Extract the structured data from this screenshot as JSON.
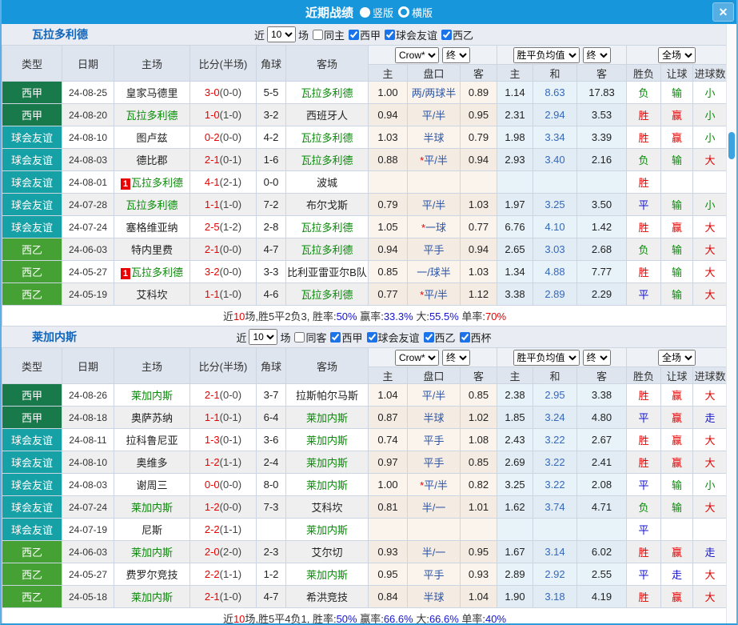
{
  "titlebar": {
    "title": "近期战绩",
    "close_glyph": "✕",
    "radio_options": [
      {
        "label": "竖版",
        "selected": true
      },
      {
        "label": "横版",
        "selected": false
      }
    ]
  },
  "colors": {
    "titlebar_bg": "#1896dc",
    "team_focus": "#0a8a0a",
    "score_ft": "#e60000",
    "score_ht": "#444444",
    "handicap": "#2d55a5",
    "handicap_star": "#e60000",
    "avg_mid": "#3668bb",
    "scroll_thumb": "#3da2e0"
  },
  "league_colors": {
    "西甲": "#18794b",
    "球会友谊": "#16a1a7",
    "西乙": "#45a133"
  },
  "result_colors": {
    "胜": "#e60000",
    "平": "#1515cc",
    "负": "#0a8a0a",
    "赢": "#e60000",
    "输": "#0a8a0a",
    "走": "#1515cc",
    "大": "#e60000",
    "小": "#0a8a0a"
  },
  "table_header": {
    "cols": [
      "类型",
      "日期",
      "主场",
      "比分(半场)",
      "角球",
      "客场"
    ],
    "odds_selects": [
      "Crow*",
      "终"
    ],
    "avg_selects": [
      "胜平负均值",
      "终"
    ],
    "scope_select": "全场",
    "sub": [
      "主",
      "盘口",
      "客",
      "主",
      "和",
      "客",
      "胜负",
      "让球",
      "进球数"
    ]
  },
  "tables": [
    {
      "team": "瓦拉多利德",
      "filter": {
        "prefix": "近",
        "count": "10",
        "suffix": "场",
        "same": {
          "label": "同主",
          "checked": false
        },
        "leagues": [
          {
            "label": "西甲",
            "checked": true
          },
          {
            "label": "球会友谊",
            "checked": true
          },
          {
            "label": "西乙",
            "checked": true
          }
        ]
      },
      "rows": [
        {
          "lg": "西甲",
          "date": "24-08-25",
          "home": "皇家马德里",
          "hb": "",
          "sc": "3-0",
          "hf": "(0-0)",
          "cn": "5-5",
          "away": "瓦拉多利德",
          "ab": "",
          "o1": "1.00",
          "hc": "两/两球半",
          "o2": "0.89",
          "a1": "1.14",
          "a2": "8.63",
          "a3": "17.83",
          "r1": "负",
          "r2": "输",
          "r3": "小"
        },
        {
          "lg": "西甲",
          "date": "24-08-20",
          "home": "瓦拉多利德",
          "hb": "",
          "sc": "1-0",
          "hf": "(1-0)",
          "cn": "3-2",
          "away": "西班牙人",
          "ab": "",
          "o1": "0.94",
          "hc": "平/半",
          "o2": "0.95",
          "a1": "2.31",
          "a2": "2.94",
          "a3": "3.53",
          "r1": "胜",
          "r2": "赢",
          "r3": "小"
        },
        {
          "lg": "球会友谊",
          "date": "24-08-10",
          "home": "图卢兹",
          "hb": "",
          "sc": "0-2",
          "hf": "(0-0)",
          "cn": "4-2",
          "away": "瓦拉多利德",
          "ab": "",
          "o1": "1.03",
          "hc": "半球",
          "o2": "0.79",
          "a1": "1.98",
          "a2": "3.34",
          "a3": "3.39",
          "r1": "胜",
          "r2": "赢",
          "r3": "小"
        },
        {
          "lg": "球会友谊",
          "date": "24-08-03",
          "home": "德比郡",
          "hb": "",
          "sc": "2-1",
          "hf": "(0-1)",
          "cn": "1-6",
          "away": "瓦拉多利德",
          "ab": "",
          "o1": "0.88",
          "hc": "*平/半",
          "o2": "0.94",
          "a1": "2.93",
          "a2": "3.40",
          "a3": "2.16",
          "r1": "负",
          "r2": "输",
          "r3": "大"
        },
        {
          "lg": "球会友谊",
          "date": "24-08-01",
          "home": "瓦拉多利德",
          "hb": "1",
          "sc": "4-1",
          "hf": "(2-1)",
          "cn": "0-0",
          "away": "波城",
          "ab": "",
          "o1": "",
          "hc": "",
          "o2": "",
          "a1": "",
          "a2": "",
          "a3": "",
          "r1": "胜",
          "r2": "",
          "r3": ""
        },
        {
          "lg": "球会友谊",
          "date": "24-07-28",
          "home": "瓦拉多利德",
          "hb": "",
          "sc": "1-1",
          "hf": "(1-0)",
          "cn": "7-2",
          "away": "布尔戈斯",
          "ab": "",
          "o1": "0.79",
          "hc": "平/半",
          "o2": "1.03",
          "a1": "1.97",
          "a2": "3.25",
          "a3": "3.50",
          "r1": "平",
          "r2": "输",
          "r3": "小"
        },
        {
          "lg": "球会友谊",
          "date": "24-07-24",
          "home": "塞格维亚纳",
          "hb": "",
          "sc": "2-5",
          "hf": "(1-2)",
          "cn": "2-8",
          "away": "瓦拉多利德",
          "ab": "",
          "o1": "1.05",
          "hc": "*一球",
          "o2": "0.77",
          "a1": "6.76",
          "a2": "4.10",
          "a3": "1.42",
          "r1": "胜",
          "r2": "赢",
          "r3": "大"
        },
        {
          "lg": "西乙",
          "date": "24-06-03",
          "home": "特内里费",
          "hb": "",
          "sc": "2-1",
          "hf": "(0-0)",
          "cn": "4-7",
          "away": "瓦拉多利德",
          "ab": "",
          "o1": "0.94",
          "hc": "平手",
          "o2": "0.94",
          "a1": "2.65",
          "a2": "3.03",
          "a3": "2.68",
          "r1": "负",
          "r2": "输",
          "r3": "大"
        },
        {
          "lg": "西乙",
          "date": "24-05-27",
          "home": "瓦拉多利德",
          "hb": "1",
          "sc": "3-2",
          "hf": "(0-0)",
          "cn": "3-3",
          "away": "比利亚雷亚尔B队",
          "ab": "",
          "o1": "0.85",
          "hc": "一/球半",
          "o2": "1.03",
          "a1": "1.34",
          "a2": "4.88",
          "a3": "7.77",
          "r1": "胜",
          "r2": "输",
          "r3": "大"
        },
        {
          "lg": "西乙",
          "date": "24-05-19",
          "home": "艾科坎",
          "hb": "",
          "sc": "1-1",
          "hf": "(1-0)",
          "cn": "4-6",
          "away": "瓦拉多利德",
          "ab": "",
          "o1": "0.77",
          "hc": "*平/半",
          "o2": "1.12",
          "a1": "3.38",
          "a2": "2.89",
          "a3": "2.29",
          "r1": "平",
          "r2": "输",
          "r3": "大"
        }
      ],
      "summary": [
        {
          "t": "近"
        },
        {
          "t": "10",
          "c": "#e60000"
        },
        {
          "t": "场,胜5平2负3, 胜率:"
        },
        {
          "t": "50%",
          "c": "#1515cc"
        },
        {
          "t": " 赢率:"
        },
        {
          "t": "33.3%",
          "c": "#1515cc"
        },
        {
          "t": " 大:"
        },
        {
          "t": "55.5%",
          "c": "#1515cc"
        },
        {
          "t": " 单率:"
        },
        {
          "t": "70%",
          "c": "#e60000"
        }
      ]
    },
    {
      "team": "莱加内斯",
      "filter": {
        "prefix": "近",
        "count": "10",
        "suffix": "场",
        "same": {
          "label": "同客",
          "checked": false
        },
        "leagues": [
          {
            "label": "西甲",
            "checked": true
          },
          {
            "label": "球会友谊",
            "checked": true
          },
          {
            "label": "西乙",
            "checked": true
          },
          {
            "label": "西杯",
            "checked": true
          }
        ]
      },
      "rows": [
        {
          "lg": "西甲",
          "date": "24-08-26",
          "home": "莱加内斯",
          "hb": "",
          "sc": "2-1",
          "hf": "(0-0)",
          "cn": "3-7",
          "away": "拉斯帕尔马斯",
          "ab": "",
          "o1": "1.04",
          "hc": "平/半",
          "o2": "0.85",
          "a1": "2.38",
          "a2": "2.95",
          "a3": "3.38",
          "r1": "胜",
          "r2": "赢",
          "r3": "大"
        },
        {
          "lg": "西甲",
          "date": "24-08-18",
          "home": "奥萨苏纳",
          "hb": "",
          "sc": "1-1",
          "hf": "(0-1)",
          "cn": "6-4",
          "away": "莱加内斯",
          "ab": "",
          "o1": "0.87",
          "hc": "半球",
          "o2": "1.02",
          "a1": "1.85",
          "a2": "3.24",
          "a3": "4.80",
          "r1": "平",
          "r2": "赢",
          "r3": "走"
        },
        {
          "lg": "球会友谊",
          "date": "24-08-11",
          "home": "拉科鲁尼亚",
          "hb": "",
          "sc": "1-3",
          "hf": "(0-1)",
          "cn": "3-6",
          "away": "莱加内斯",
          "ab": "",
          "o1": "0.74",
          "hc": "平手",
          "o2": "1.08",
          "a1": "2.43",
          "a2": "3.22",
          "a3": "2.67",
          "r1": "胜",
          "r2": "赢",
          "r3": "大"
        },
        {
          "lg": "球会友谊",
          "date": "24-08-10",
          "home": "奥维多",
          "hb": "",
          "sc": "1-2",
          "hf": "(1-1)",
          "cn": "2-4",
          "away": "莱加内斯",
          "ab": "",
          "o1": "0.97",
          "hc": "平手",
          "o2": "0.85",
          "a1": "2.69",
          "a2": "3.22",
          "a3": "2.41",
          "r1": "胜",
          "r2": "赢",
          "r3": "大"
        },
        {
          "lg": "球会友谊",
          "date": "24-08-03",
          "home": "谢周三",
          "hb": "",
          "sc": "0-0",
          "hf": "(0-0)",
          "cn": "8-0",
          "away": "莱加内斯",
          "ab": "",
          "o1": "1.00",
          "hc": "*平/半",
          "o2": "0.82",
          "a1": "3.25",
          "a2": "3.22",
          "a3": "2.08",
          "r1": "平",
          "r2": "输",
          "r3": "小"
        },
        {
          "lg": "球会友谊",
          "date": "24-07-24",
          "home": "莱加内斯",
          "hb": "",
          "sc": "1-2",
          "hf": "(0-0)",
          "cn": "7-3",
          "away": "艾科坎",
          "ab": "",
          "o1": "0.81",
          "hc": "半/一",
          "o2": "1.01",
          "a1": "1.62",
          "a2": "3.74",
          "a3": "4.71",
          "r1": "负",
          "r2": "输",
          "r3": "大"
        },
        {
          "lg": "球会友谊",
          "date": "24-07-19",
          "home": "尼斯",
          "hb": "",
          "sc": "2-2",
          "hf": "(1-1)",
          "cn": "",
          "away": "莱加内斯",
          "ab": "",
          "o1": "",
          "hc": "",
          "o2": "",
          "a1": "",
          "a2": "",
          "a3": "",
          "r1": "平",
          "r2": "",
          "r3": ""
        },
        {
          "lg": "西乙",
          "date": "24-06-03",
          "home": "莱加内斯",
          "hb": "",
          "sc": "2-0",
          "hf": "(2-0)",
          "cn": "2-3",
          "away": "艾尔切",
          "ab": "",
          "o1": "0.93",
          "hc": "半/一",
          "o2": "0.95",
          "a1": "1.67",
          "a2": "3.14",
          "a3": "6.02",
          "r1": "胜",
          "r2": "赢",
          "r3": "走"
        },
        {
          "lg": "西乙",
          "date": "24-05-27",
          "home": "费罗尔竞技",
          "hb": "",
          "sc": "2-2",
          "hf": "(1-1)",
          "cn": "1-2",
          "away": "莱加内斯",
          "ab": "",
          "o1": "0.95",
          "hc": "平手",
          "o2": "0.93",
          "a1": "2.89",
          "a2": "2.92",
          "a3": "2.55",
          "r1": "平",
          "r2": "走",
          "r3": "大"
        },
        {
          "lg": "西乙",
          "date": "24-05-18",
          "home": "莱加内斯",
          "hb": "",
          "sc": "2-1",
          "hf": "(1-0)",
          "cn": "4-7",
          "away": "希洪竞技",
          "ab": "",
          "o1": "0.84",
          "hc": "半球",
          "o2": "1.04",
          "a1": "1.90",
          "a2": "3.18",
          "a3": "4.19",
          "r1": "胜",
          "r2": "赢",
          "r3": "大"
        }
      ],
      "summary": [
        {
          "t": "近"
        },
        {
          "t": "10",
          "c": "#e60000"
        },
        {
          "t": "场,胜5平4负1, 胜率:"
        },
        {
          "t": "50%",
          "c": "#1515cc"
        },
        {
          "t": " 赢率:"
        },
        {
          "t": "66.6%",
          "c": "#1515cc"
        },
        {
          "t": " 大:"
        },
        {
          "t": "66.6%",
          "c": "#1515cc"
        },
        {
          "t": " 单率:"
        },
        {
          "t": "40%",
          "c": "#1515cc"
        }
      ]
    }
  ]
}
